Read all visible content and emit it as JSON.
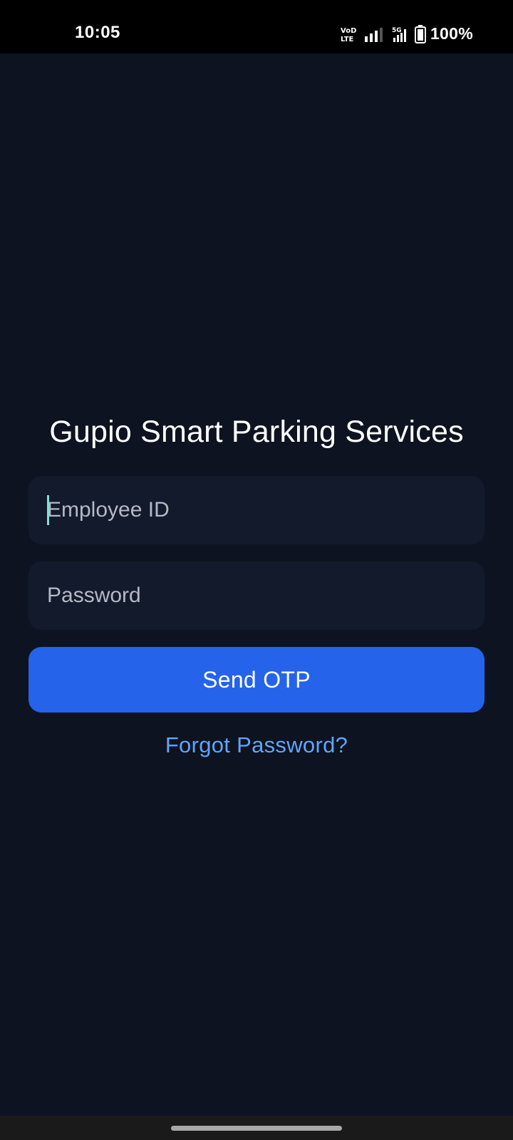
{
  "status_bar": {
    "time": "10:05",
    "volte_icon": "volte-icon",
    "network_type": "5G",
    "battery": "100%"
  },
  "app": {
    "title": "Gupio Smart Parking Services"
  },
  "form": {
    "employee_id": {
      "value": "",
      "placeholder": "Employee ID"
    },
    "password": {
      "value": "",
      "placeholder": "Password"
    },
    "send_otp_label": "Send OTP",
    "forgot_password_label": "Forgot Password?"
  },
  "colors": {
    "background": "#0d1320",
    "field_background": "#121a2c",
    "accent": "#2563eb",
    "link": "#60a5fa"
  }
}
